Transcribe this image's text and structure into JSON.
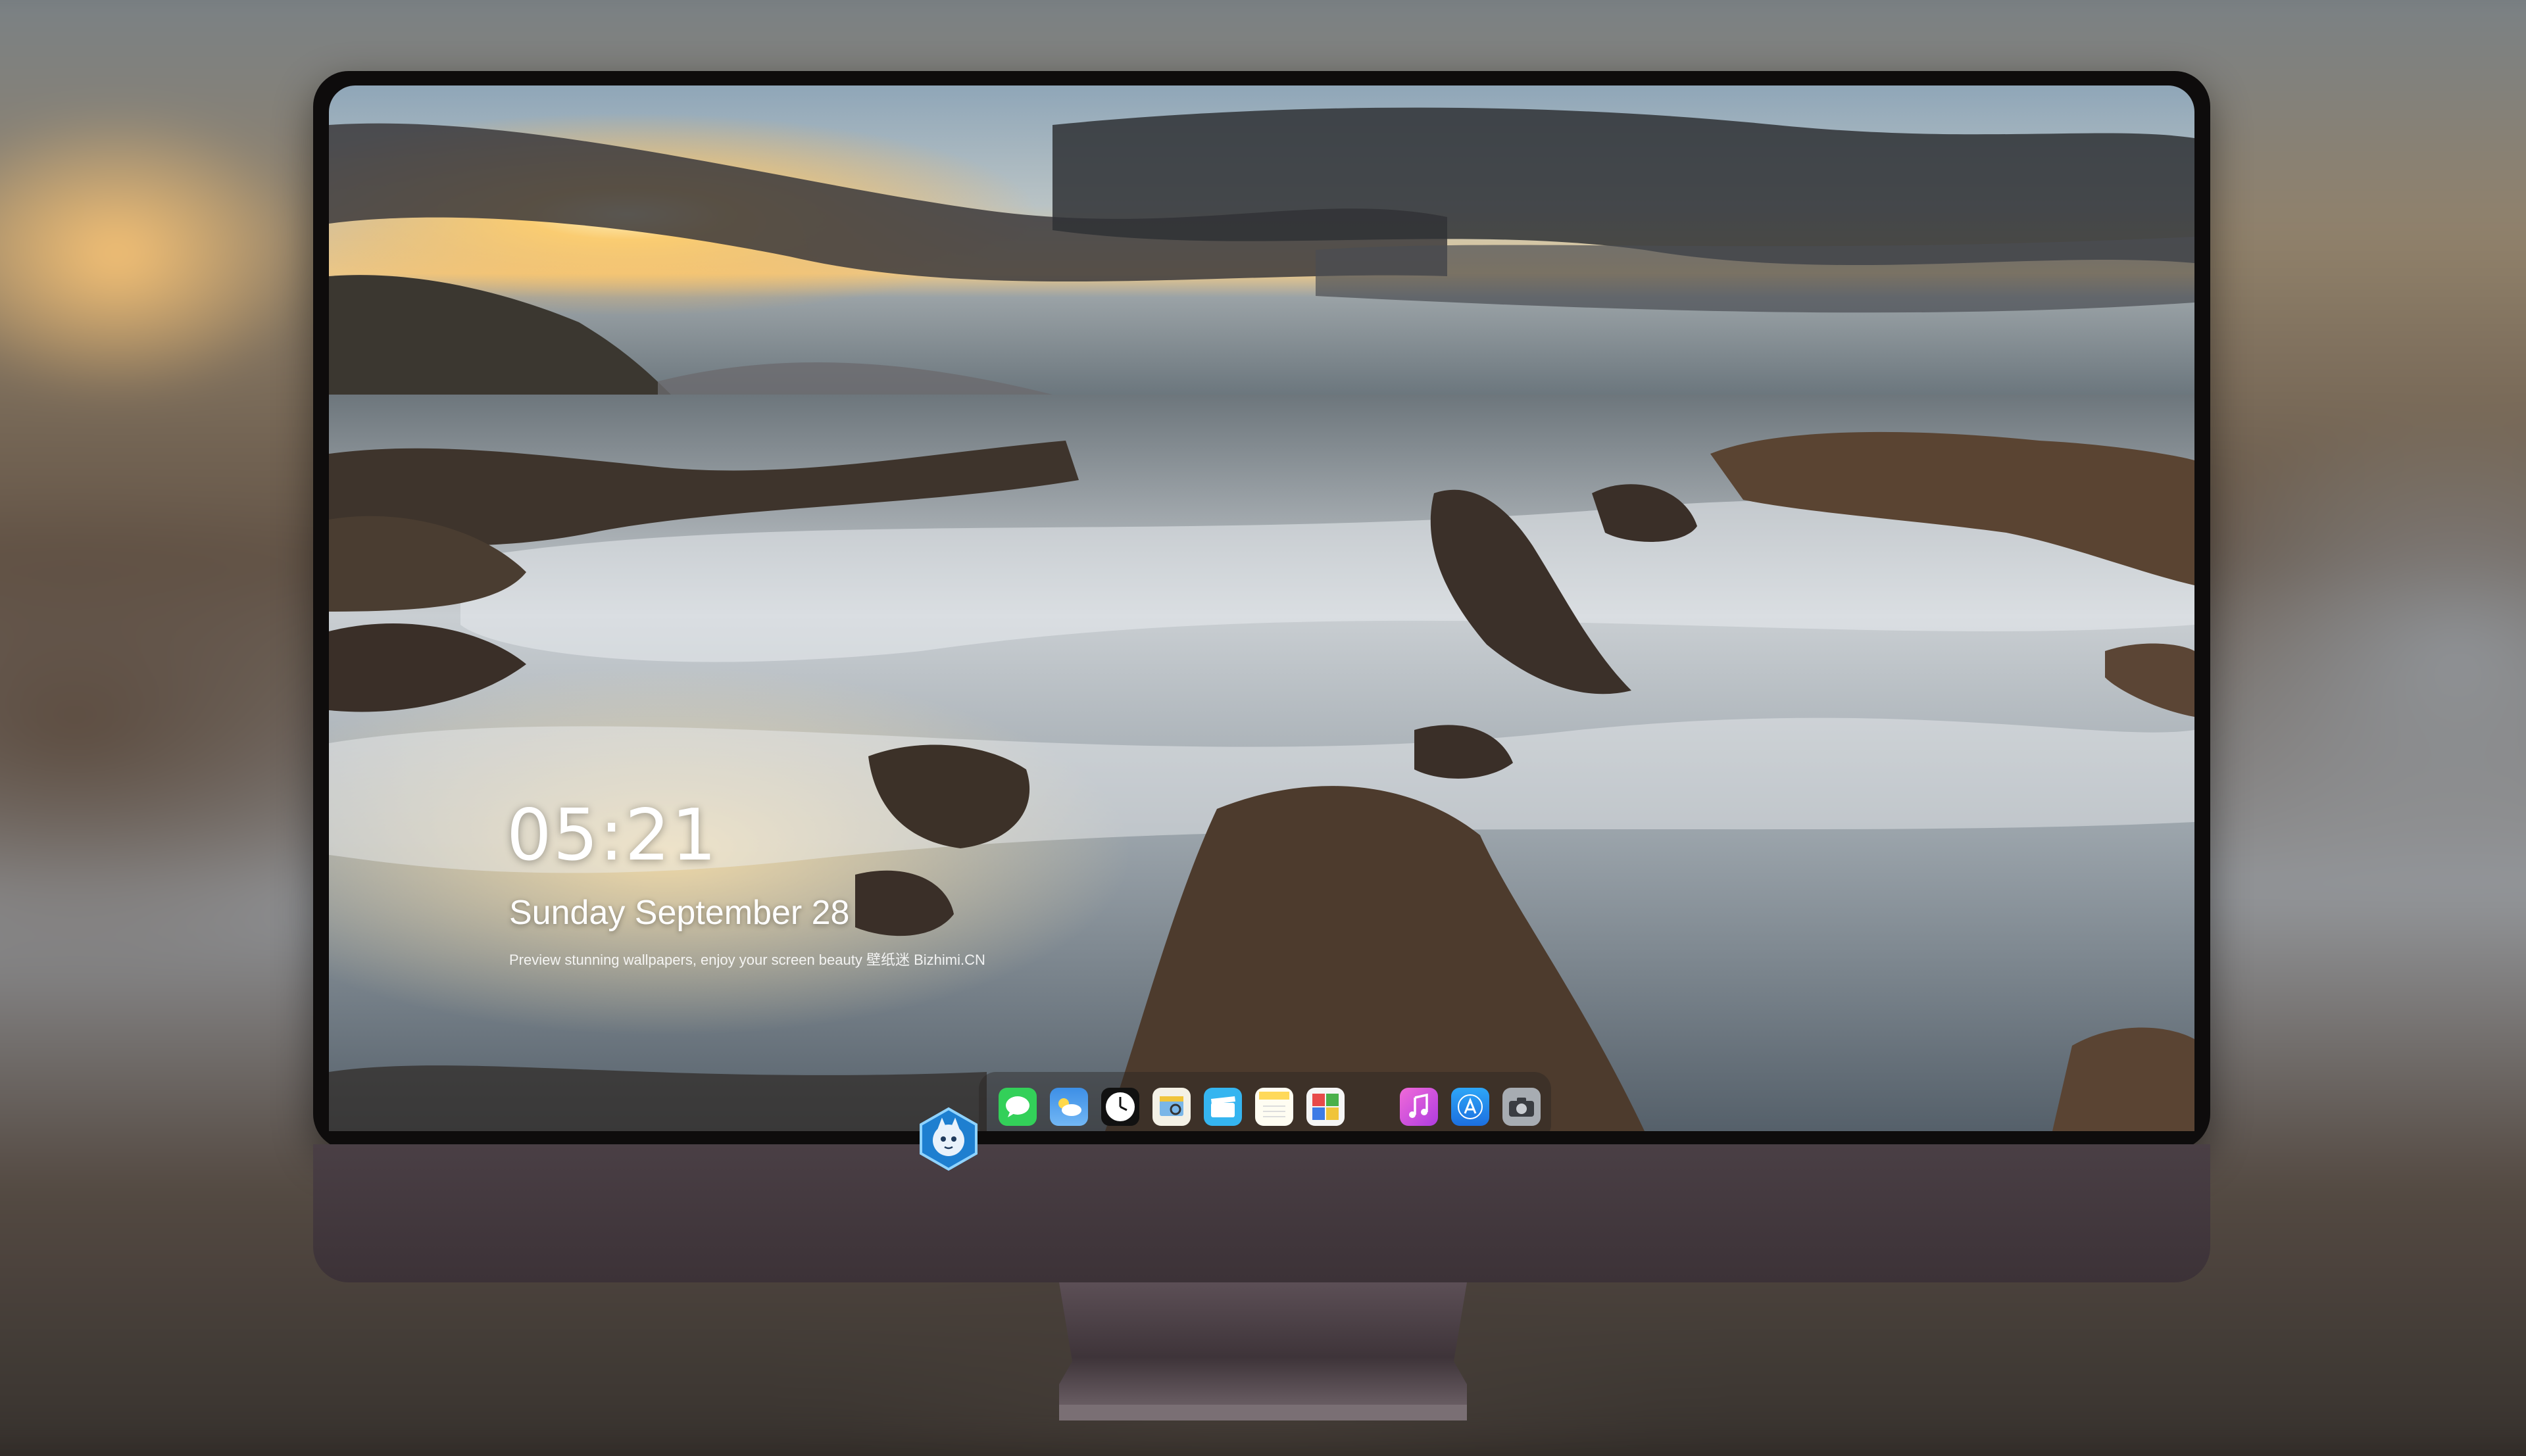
{
  "lock_screen": {
    "time": "05:21",
    "date": "Sunday September 28",
    "caption": "Preview stunning wallpapers, enjoy your screen beauty 壁纸迷 Bizhimi.CN"
  },
  "dock": {
    "apps": [
      {
        "name": "Messages",
        "icon": "messages-icon",
        "color": "#33d059",
        "running": false
      },
      {
        "name": "Weather",
        "icon": "weather-icon",
        "color": "#3d8fe6",
        "running": false
      },
      {
        "name": "Clock",
        "icon": "clock-icon",
        "color": "#111111",
        "running": true
      },
      {
        "name": "Preview",
        "icon": "preview-icon",
        "color": "#f0c43a",
        "running": false
      },
      {
        "name": "Clips",
        "icon": "clips-icon",
        "color": "#35b5f0",
        "running": false
      },
      {
        "name": "Notes",
        "icon": "notes-icon",
        "color": "#ffd95a",
        "running": false
      },
      {
        "name": "Photo Booth",
        "icon": "photo-booth-icon",
        "color": "#e84a4a",
        "running": false
      },
      {
        "name": "iTunes",
        "icon": "itunes-icon",
        "color": "#d44adf",
        "running": false
      },
      {
        "name": "App Store",
        "icon": "app-store-icon",
        "color": "#1c8cf0",
        "running": false
      },
      {
        "name": "Screenshot",
        "icon": "camera-icon",
        "color": "#8a8f96",
        "running": false
      }
    ]
  },
  "colors": {
    "monitor_chin": "#3f353a",
    "bezel": "#0e0c0c"
  }
}
